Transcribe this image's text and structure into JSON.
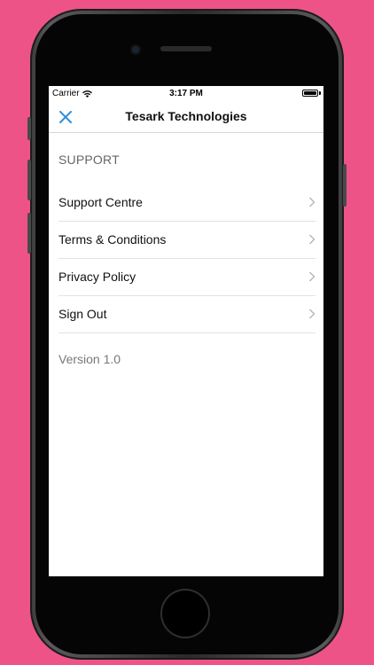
{
  "status_bar": {
    "carrier": "Carrier",
    "time": "3:17 PM",
    "battery_level": 1.0
  },
  "nav": {
    "title": "Tesark Technologies",
    "close_icon": "close-icon",
    "accent_color": "#2f8fd8"
  },
  "section": {
    "header": "SUPPORT"
  },
  "menu": {
    "items": [
      {
        "label": "Support Centre",
        "icon": "chevron-right-icon"
      },
      {
        "label": "Terms & Conditions",
        "icon": "chevron-right-icon"
      },
      {
        "label": "Privacy Policy",
        "icon": "chevron-right-icon"
      },
      {
        "label": "Sign Out",
        "icon": "chevron-right-icon"
      }
    ]
  },
  "footer": {
    "version": "Version 1.0"
  },
  "colors": {
    "background": "#ee5387",
    "screen": "#ffffff"
  }
}
